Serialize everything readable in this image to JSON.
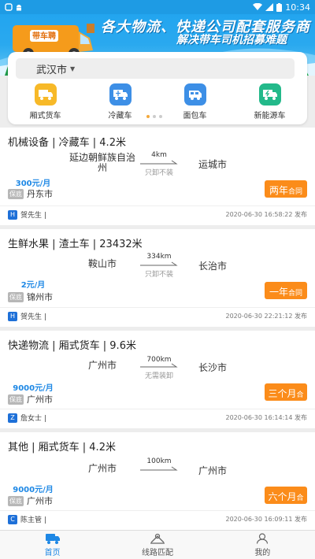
{
  "status_bar": {
    "time": "10:34"
  },
  "banner": {
    "van_text": "带车聘",
    "slogan_line1": "各大物流、快递公司配套服务商",
    "slogan_line2": "解决带车司机招募难题"
  },
  "city_select": {
    "value": "武汉市"
  },
  "categories": [
    {
      "label": "厢式货车",
      "icon": "box-truck-icon",
      "color": "#f7b928"
    },
    {
      "label": "冷藏车",
      "icon": "refrigerated-truck-icon",
      "color": "#3d8fe6"
    },
    {
      "label": "面包车",
      "icon": "van-icon",
      "color": "#3d8fe6"
    },
    {
      "label": "新能源车",
      "icon": "ev-truck-icon",
      "color": "#23b98a"
    }
  ],
  "listings": [
    {
      "title": "机械设备 | 冷藏车 | 4.2米",
      "from": "延边朝鲜族自治州",
      "to": "运城市",
      "distance": "4km",
      "load_note": "只卸不装",
      "price": "300元/月",
      "pay_tag": "保底",
      "origin": "丹东市",
      "term_main": "两年",
      "term_suffix": "合同",
      "poster_badge": "H",
      "poster": "贺先生 |",
      "time": "2020-06-30 16:58:22 发布"
    },
    {
      "title": "生鲜水果 | 渣土车 | 23432米",
      "from": "鞍山市",
      "to": "长治市",
      "distance": "334km",
      "load_note": "只卸不装",
      "price": "2元/月",
      "pay_tag": "保底",
      "origin": "锦州市",
      "term_main": "一年",
      "term_suffix": "合同",
      "poster_badge": "H",
      "poster": "贺先生 |",
      "time": "2020-06-30 22:21:12 发布"
    },
    {
      "title": "快递物流 | 厢式货车 | 9.6米",
      "from": "广州市",
      "to": "长沙市",
      "distance": "700km",
      "load_note": "无需装卸",
      "price": "9000元/月",
      "pay_tag": "保底",
      "origin": "广州市",
      "term_main": "三个月",
      "term_suffix": "合",
      "poster_badge": "Z",
      "poster": "詹女士 |",
      "time": "2020-06-30 16:14:14 发布"
    },
    {
      "title": "其他 | 厢式货车 | 4.2米",
      "from": "广州市",
      "to": "广州市",
      "distance": "100km",
      "load_note": "",
      "price": "9000元/月",
      "pay_tag": "保底",
      "origin": "广州市",
      "term_main": "六个月",
      "term_suffix": "合",
      "poster_badge": "C",
      "poster": "陈主管 |",
      "time": "2020-06-30 16:09:11 发布"
    }
  ],
  "bottom_nav": [
    {
      "label": "首页",
      "icon": "home-truck-icon",
      "active": true
    },
    {
      "label": "线路匹配",
      "icon": "route-match-icon",
      "active": false
    },
    {
      "label": "我的",
      "icon": "profile-icon",
      "active": false
    }
  ],
  "colors": {
    "primary": "#1e88e5",
    "accent": "#fb8c1a",
    "banner": "#1fa3ef"
  }
}
